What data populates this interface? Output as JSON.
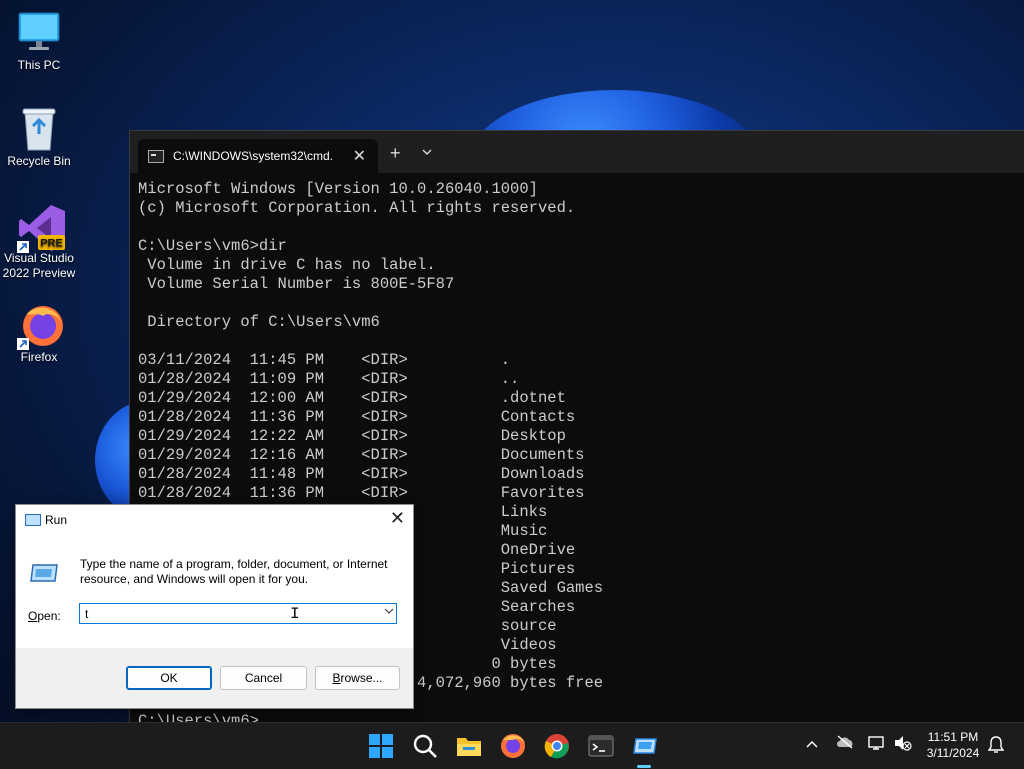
{
  "desktop_icons": [
    {
      "label": "This PC"
    },
    {
      "label": "Recycle Bin"
    },
    {
      "label": "Visual Studio 2022 Preview",
      "badge": "PRE"
    },
    {
      "label": "Firefox"
    }
  ],
  "terminal": {
    "tab_title": "C:\\WINDOWS\\system32\\cmd.",
    "tab_close": "✕",
    "new_tab": "+",
    "dropdown": "⌄",
    "lines": [
      "Microsoft Windows [Version 10.0.26040.1000]",
      "(c) Microsoft Corporation. All rights reserved.",
      "",
      "C:\\Users\\vm6>dir",
      " Volume in drive C has no label.",
      " Volume Serial Number is 800E-5F87",
      "",
      " Directory of C:\\Users\\vm6",
      "",
      "03/11/2024  11:45 PM    <DIR>          .",
      "01/28/2024  11:09 PM    <DIR>          ..",
      "01/29/2024  12:00 AM    <DIR>          .dotnet",
      "01/28/2024  11:36 PM    <DIR>          Contacts",
      "01/29/2024  12:22 AM    <DIR>          Desktop",
      "01/29/2024  12:16 AM    <DIR>          Documents",
      "01/28/2024  11:48 PM    <DIR>          Downloads",
      "01/28/2024  11:36 PM    <DIR>          Favorites",
      "                                       Links",
      "                                       Music",
      "                                       OneDrive",
      "                                       Pictures",
      "                                       Saved Games",
      "                                       Searches",
      "                                       source",
      "                                       Videos",
      "                                      0 bytes",
      "                              4,072,960 bytes free",
      "",
      "C:\\Users\\vm6>"
    ]
  },
  "run_dialog": {
    "title": "Run",
    "close": "✕",
    "description": "Type the name of a program, folder, document, or Internet resource, and Windows will open it for you.",
    "open_label_underlined": "O",
    "open_label_rest": "pen:",
    "open_value": "t",
    "ok_label": "OK",
    "cancel_label": "Cancel",
    "browse_label_underlined": "B",
    "browse_label_rest": "rowse..."
  },
  "taskbar": {
    "apps": [
      "start-icon",
      "search-icon",
      "file-explorer-icon",
      "firefox-icon",
      "chrome-icon",
      "terminal-icon",
      "run-icon"
    ],
    "tray_chevron": "^",
    "clock_time": "11:51 PM",
    "clock_date": "3/11/2024"
  },
  "colors": {
    "terminal_bg": "#0c0c0c",
    "terminal_text": "#cccccc",
    "accent": "#0078d4",
    "taskbar_bg": "#1c1c1c"
  }
}
